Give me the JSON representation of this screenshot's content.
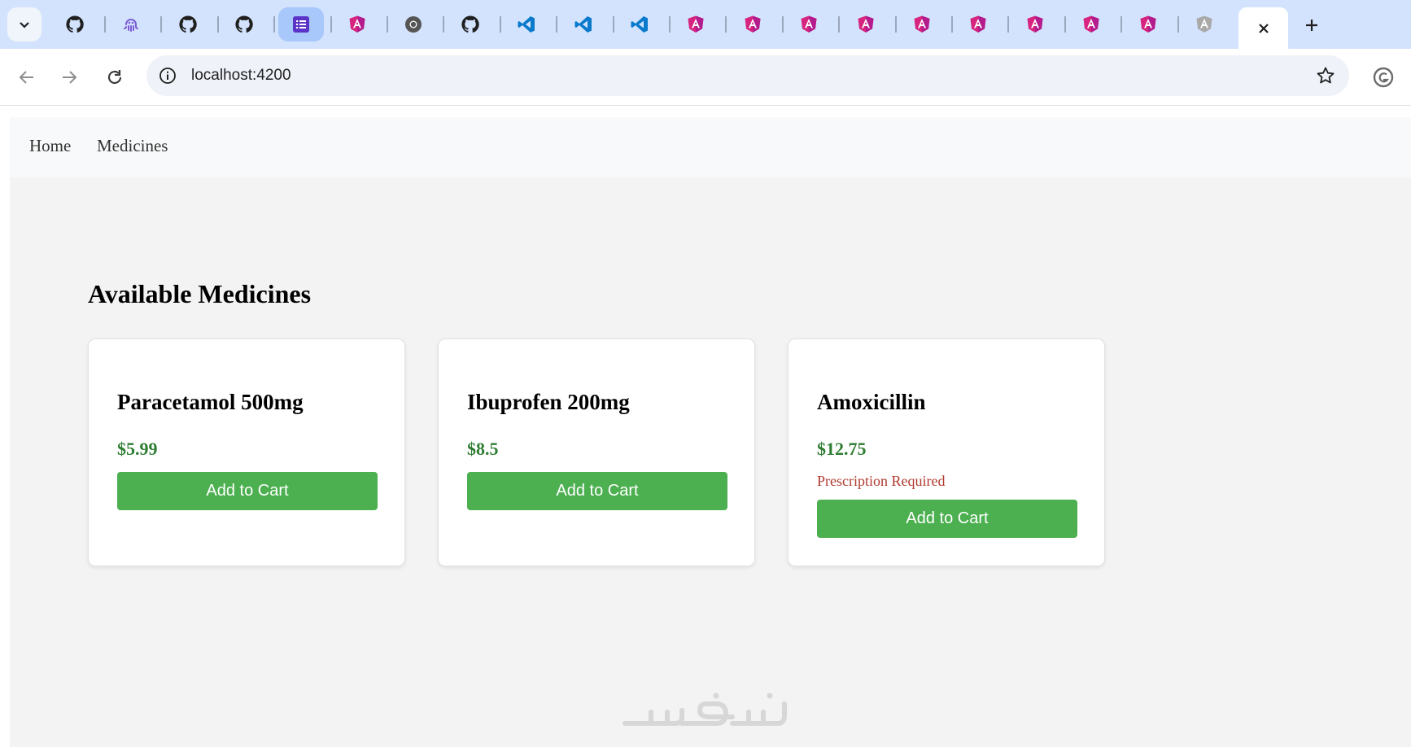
{
  "browser": {
    "tabs": [
      {
        "icon": "github-icon"
      },
      {
        "icon": "octopus-icon"
      },
      {
        "icon": "github-icon"
      },
      {
        "icon": "github-icon"
      },
      {
        "icon": "form-list-icon"
      },
      {
        "icon": "angular-icon"
      },
      {
        "icon": "chrome-icon"
      },
      {
        "icon": "github-icon"
      },
      {
        "icon": "vscode-icon"
      },
      {
        "icon": "vscode-icon"
      },
      {
        "icon": "vscode-icon"
      },
      {
        "icon": "angular-icon"
      },
      {
        "icon": "angular-icon"
      },
      {
        "icon": "angular-icon"
      },
      {
        "icon": "angular-icon"
      },
      {
        "icon": "angular-icon"
      },
      {
        "icon": "angular-icon"
      },
      {
        "icon": "angular-icon"
      },
      {
        "icon": "angular-icon"
      },
      {
        "icon": "angular-icon"
      },
      {
        "icon": "angular-gray-icon"
      }
    ],
    "address": "localhost:4200"
  },
  "site": {
    "nav": {
      "home": "Home",
      "medicines": "Medicines"
    },
    "heading": "Available Medicines",
    "medicines": [
      {
        "name": "Paracetamol 500mg",
        "price": "$5.99",
        "note": "",
        "button": "Add to Cart"
      },
      {
        "name": "Ibuprofen 200mg",
        "price": "$8.5",
        "note": "",
        "button": "Add to Cart"
      },
      {
        "name": "Amoxicillin",
        "price": "$12.75",
        "note": "Prescription Required",
        "button": "Add to Cart"
      }
    ]
  },
  "colors": {
    "accent_green": "#4caf50",
    "price_green": "#2e7d32",
    "prescription_red": "#b03a2e",
    "tabstrip": "#d3e3fd"
  },
  "watermark": "خمسات"
}
